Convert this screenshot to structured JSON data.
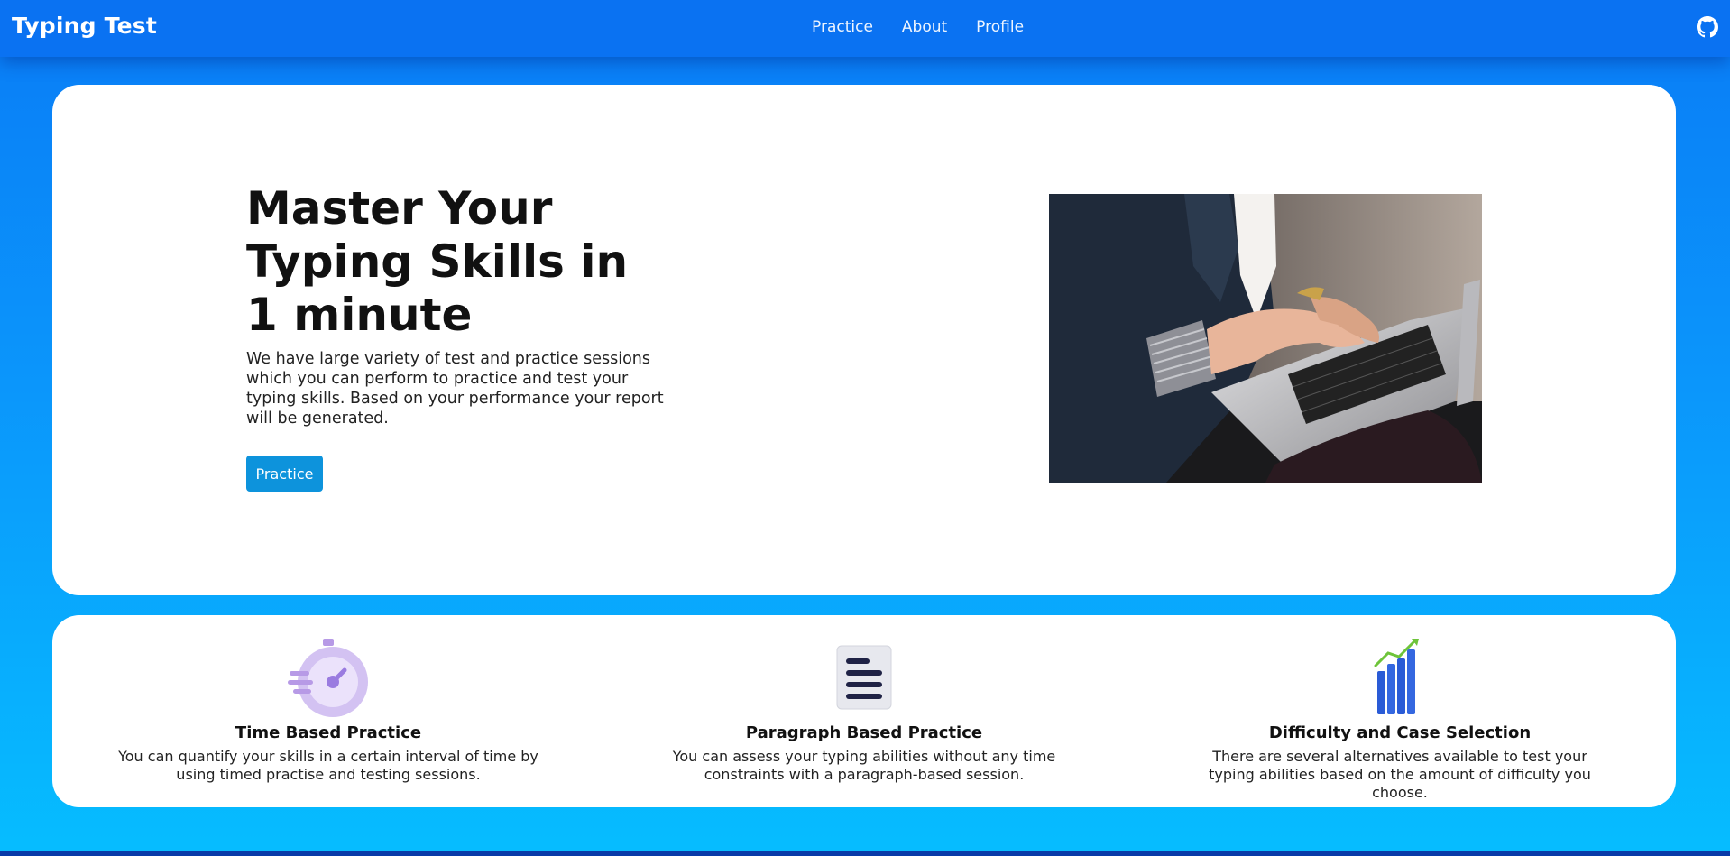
{
  "nav": {
    "brand": "Typing Test",
    "links": [
      "Practice",
      "About",
      "Profile"
    ]
  },
  "hero": {
    "title": "Master Your Typing Skills in 1 minute",
    "description": "We have large variety of test and practice sessions which you can perform to practice and test your typing skills. Based on your performance your report will be generated.",
    "button": "Practice"
  },
  "features": [
    {
      "icon": "stopwatch-icon",
      "title": "Time Based Practice",
      "text": "You can quantify your skills in a certain interval of time by using timed practise and testing sessions."
    },
    {
      "icon": "paragraph-icon",
      "title": "Paragraph Based Practice",
      "text": "You can assess your typing abilities without any time constraints with a paragraph-based session."
    },
    {
      "icon": "bar-chart-icon",
      "title": "Difficulty and Case Selection",
      "text": "There are several alternatives available to test your typing abilities based on the amount of difficulty you choose."
    }
  ],
  "colors": {
    "navbar": "#0a72f2",
    "button": "#0d93dc",
    "background_top": "#0a7cf6",
    "background_bottom": "#06bdff"
  }
}
